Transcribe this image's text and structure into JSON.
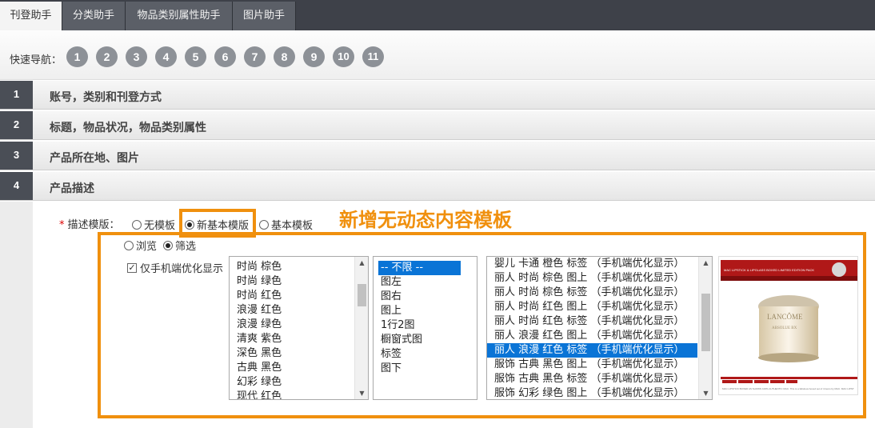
{
  "tabs": [
    {
      "label": "刊登助手",
      "active": true
    },
    {
      "label": "分类助手",
      "active": false
    },
    {
      "label": "物品类别属性助手",
      "active": false
    },
    {
      "label": "图片助手",
      "active": false
    }
  ],
  "quick_nav": {
    "label": "快速导航：",
    "items": [
      "1",
      "2",
      "3",
      "4",
      "5",
      "6",
      "7",
      "8",
      "9",
      "10",
      "11"
    ]
  },
  "sections": [
    {
      "number": "1",
      "title": "账号，类别和刊登方式"
    },
    {
      "number": "2",
      "title": "标题，物品状况，物品类别属性"
    },
    {
      "number": "3",
      "title": "产品所在地、图片"
    },
    {
      "number": "4",
      "title": "产品描述"
    }
  ],
  "description_template": {
    "required_mark": "*",
    "label": "描述模版：",
    "options": [
      {
        "label": "无模板",
        "selected": false
      },
      {
        "label": "新基本模版",
        "selected": true
      },
      {
        "label": "基本模板",
        "selected": false
      }
    ],
    "mode_options": [
      {
        "label": "浏览",
        "selected": false
      },
      {
        "label": "筛选",
        "selected": true
      }
    ],
    "mobile_only": {
      "label": "仅手机端优化显示",
      "checked": true
    }
  },
  "annotation": "新增无动态内容模板",
  "style_list": {
    "items": [
      "时尚 棕色",
      "时尚 绿色",
      "时尚 红色",
      "浪漫 红色",
      "浪漫 绿色",
      "清爽 紫色",
      "深色 黑色",
      "古典 黑色",
      "幻彩 绿色",
      "现代 红色"
    ]
  },
  "layout_list": {
    "items": [
      "-- 不限 --",
      "图左",
      "图右",
      "图上",
      "1行2图",
      "橱窗式图",
      "标签",
      "图下"
    ],
    "selected_index": 0
  },
  "template_list": {
    "items": [
      "婴儿 卡通 橙色 标签 （手机端优化显示）",
      "丽人 时尚 棕色 图上 （手机端优化显示）",
      "丽人 时尚 棕色 标签 （手机端优化显示）",
      "丽人 时尚 红色 图上 （手机端优化显示）",
      "丽人 时尚 红色 标签 （手机端优化显示）",
      "丽人 浪漫 红色 图上 （手机端优化显示）",
      "丽人 浪漫 红色 标签 （手机端优化显示）",
      "服饰 古典 黑色 图上 （手机端优化显示）",
      "服饰 古典 黑色 标签 （手机端优化显示）",
      "服饰 幻彩 绿色 图上 （手机端优化显示）"
    ],
    "selected_index": 6
  },
  "preview": {
    "banner_text": "MAC LIPSTICK & LIPGLASS BOXED LIMITED EDITION PACK",
    "brand_text": "LANCÔME",
    "product_text": "ABSOLUE BX",
    "footer_text": "MAC LIPSTICK BOXED AS SHOWN 100% AUTHENTIC MAC. This is a fabulous boxed set of 4 items by MAC. MAC LIPST"
  },
  "colors": {
    "accent_orange": "#f0900e",
    "select_blue": "#0a74d6",
    "tab_dark": "#3e4149",
    "nav_gray": "#8d9197"
  }
}
